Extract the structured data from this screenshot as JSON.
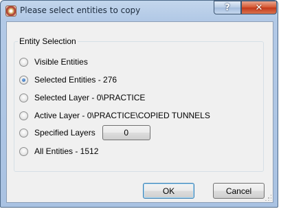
{
  "window": {
    "title": "Please select entities to copy",
    "help_label": "?",
    "close_label": "✕"
  },
  "group": {
    "label": "Entity Selection",
    "options": [
      {
        "label": "Visible Entities",
        "checked": false
      },
      {
        "label": "Selected Entities - 276",
        "checked": true
      },
      {
        "label": "Selected Layer - 0\\PRACTICE",
        "checked": false
      },
      {
        "label": "Active Layer - 0\\PRACTICE\\COPIED TUNNELS",
        "checked": false
      },
      {
        "label": "Specified Layers",
        "checked": false
      },
      {
        "label": "All Entities - 1512",
        "checked": false
      }
    ],
    "specified_layers_value": "0"
  },
  "buttons": {
    "ok_label": "OK",
    "cancel_label": "Cancel"
  }
}
